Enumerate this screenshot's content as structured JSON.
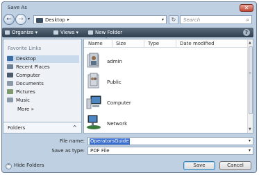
{
  "window": {
    "title": "Save As",
    "close_label": "✕"
  },
  "nav": {
    "back_icon": "←",
    "forward_icon": "→",
    "dropdown_icon": "▾",
    "address_crumb": "Desktop",
    "address_arrow": "▸",
    "address_dropdown": "▾",
    "refresh_icon": "↻",
    "search_placeholder": "Search",
    "search_icon": "⌕"
  },
  "toolbar": {
    "organize": "Organize ▾",
    "views": "Views ▾",
    "new_folder": "New Folder",
    "help": "?"
  },
  "favorites": {
    "heading": "Favorite Links",
    "items": [
      {
        "label": "Desktop",
        "color": "#3b6ea5"
      },
      {
        "label": "Recent Places",
        "color": "#6d7f92"
      },
      {
        "label": "Computer",
        "color": "#4a5a6a"
      },
      {
        "label": "Documents",
        "color": "#8a9aa9"
      },
      {
        "label": "Pictures",
        "color": "#7e9a6e"
      },
      {
        "label": "Music",
        "color": "#8a9aa9"
      },
      {
        "label": "More »",
        "color": ""
      }
    ],
    "folders_label": "Folders",
    "folders_chevron": "^"
  },
  "columns": [
    "Name",
    "Size",
    "Type",
    "Date modified"
  ],
  "files": [
    {
      "name": "admin",
      "icon": "user-folder-icon"
    },
    {
      "name": "Public",
      "icon": "public-folder-icon"
    },
    {
      "name": "Computer",
      "icon": "computer-icon"
    },
    {
      "name": "Network",
      "icon": "network-icon"
    }
  ],
  "form": {
    "filename_label": "File name:",
    "filename_value": "OperatorsGuide",
    "type_label": "Save as type:",
    "type_value": "PDF File",
    "dropdown": "▾"
  },
  "footer": {
    "hide_folders": "Hide Folders",
    "hide_icon": "^",
    "save": "Save",
    "cancel": "Cancel"
  }
}
